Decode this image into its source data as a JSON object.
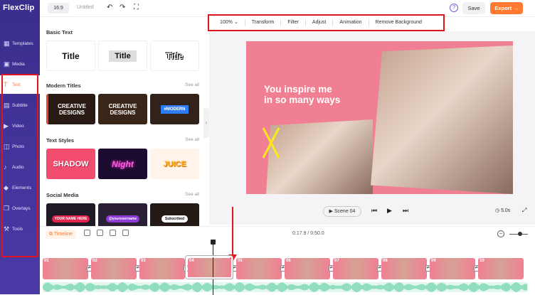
{
  "app": {
    "logo": "FlexClip"
  },
  "topbar": {
    "ratio": "16:9",
    "title": "Untitled",
    "help": "?",
    "save_label": "Save",
    "export_label": "Export →"
  },
  "toolbar": {
    "zoom": "100% ⌄",
    "items": [
      "Transform",
      "Filter",
      "Adjust",
      "Animation",
      "Remove Background"
    ]
  },
  "sidebar": {
    "items": [
      {
        "label": "Templates",
        "icon": "templates-icon"
      },
      {
        "label": "Media",
        "icon": "media-icon"
      },
      {
        "label": "Text",
        "icon": "text-icon",
        "active": true
      },
      {
        "label": "Subtitle",
        "icon": "subtitle-icon"
      },
      {
        "label": "Video",
        "icon": "video-icon"
      },
      {
        "label": "Photo",
        "icon": "photo-icon"
      },
      {
        "label": "Audio",
        "icon": "audio-icon"
      },
      {
        "label": "Elements",
        "icon": "elements-icon"
      },
      {
        "label": "Overlays",
        "icon": "overlays-icon"
      },
      {
        "label": "Tools",
        "icon": "tools-icon"
      }
    ]
  },
  "panel": {
    "basic_text": {
      "title": "Basic Text",
      "tiles": [
        "Title",
        "Title",
        "Title"
      ]
    },
    "modern_titles": {
      "title": "Modern Titles",
      "see_all": "See all",
      "tiles": [
        "CREATIVE DESIGNS",
        "CREATIVE DESIGNS",
        "#MODERN"
      ]
    },
    "text_styles": {
      "title": "Text Styles",
      "see_all": "See all",
      "tiles": [
        "SHADOW",
        "Night",
        "JUICE"
      ]
    },
    "social_media": {
      "title": "Social Media",
      "see_all": "See all",
      "tiles": [
        "YOUR NAME HERE",
        "@yourusername",
        "Subscribed"
      ]
    }
  },
  "canvas": {
    "caption_line1": "You inspire me",
    "caption_line2": "in so many ways"
  },
  "player": {
    "scene_label": "Scene 04",
    "duration": "5.0s"
  },
  "timeline": {
    "label": "Timeline",
    "timecode": "0:17.9 / 0:50.0",
    "progress": 0.358,
    "clips": [
      "01",
      "02",
      "03",
      "04",
      "05",
      "06",
      "07",
      "08",
      "09",
      "10"
    ]
  },
  "colors": {
    "accent": "#ff7a30",
    "sidebar": "#3a2e8c",
    "highlight": "#e0141e",
    "canvas_bg": "#f07f93"
  }
}
